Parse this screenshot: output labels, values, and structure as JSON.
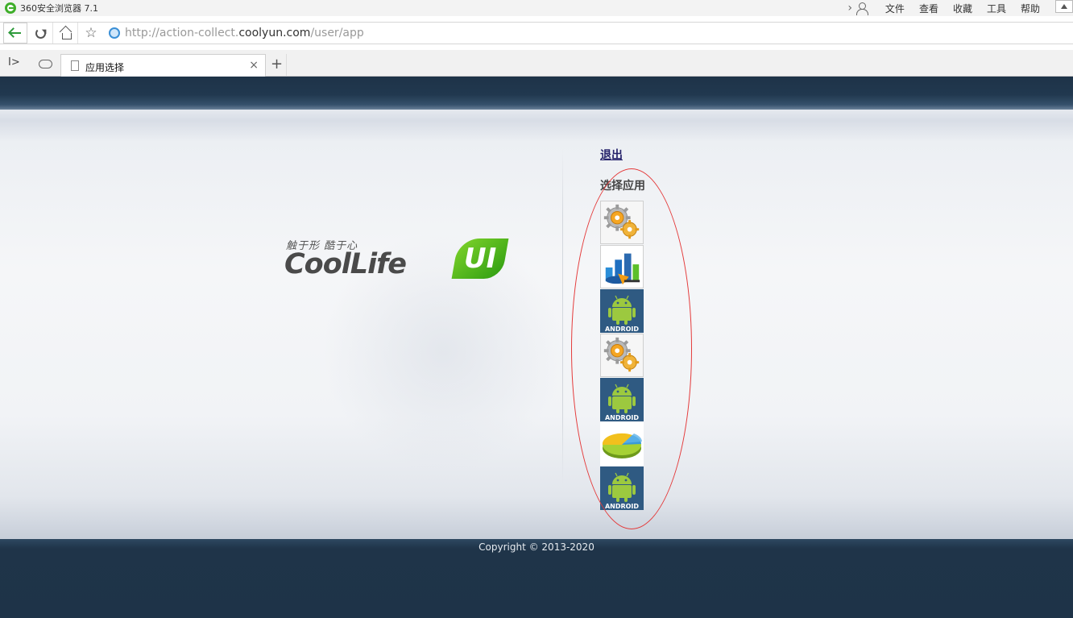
{
  "window": {
    "app_title": "360安全浏览器 7.1",
    "menu": [
      "文件",
      "查看",
      "收藏",
      "工具",
      "帮助"
    ]
  },
  "address_bar": {
    "url_prefix": "http://action-collect.",
    "url_domain": "coolyun.com",
    "url_path": "/user/app"
  },
  "tabs": [
    {
      "label": "应用选择",
      "active": true
    }
  ],
  "page": {
    "logo": {
      "slogan": "触于形 酷于心",
      "wordmark": "CoolLife",
      "badge": "UI"
    },
    "logout_link": "退出",
    "section_title": "选择应用",
    "apps": [
      {
        "icon": "gear-app-icon"
      },
      {
        "icon": "chart-app-icon"
      },
      {
        "icon": "android-app-icon"
      },
      {
        "icon": "gear-app-icon"
      },
      {
        "icon": "android-app-icon"
      },
      {
        "icon": "pie-chart-app-icon"
      },
      {
        "icon": "android-app-icon"
      }
    ],
    "android_label": "ANDROID",
    "copyright": "Copyright © 2013-2020"
  },
  "colors": {
    "header_bg": "#1e3348",
    "highlight_ring": "#e43a3a",
    "logo_green": "#4caf1e",
    "android_tile": "#2f5a82"
  }
}
